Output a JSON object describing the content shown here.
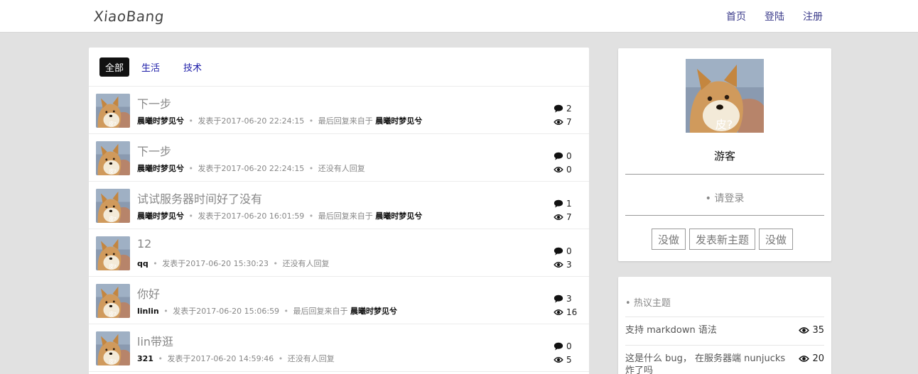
{
  "nav": {
    "logo": "XiaoBang",
    "links": [
      "首页",
      "登陆",
      "注册"
    ]
  },
  "tabs": [
    "全部",
    "生活",
    "技术"
  ],
  "topics": [
    {
      "title": "下一步",
      "author": "晨曦时梦见兮",
      "posted": "发表于2017-06-20 22:24:15",
      "reply_text": "最后回复来自于",
      "replier": "晨曦时梦见兮",
      "comments": "2",
      "views": "7"
    },
    {
      "title": "下一步",
      "author": "晨曦时梦见兮",
      "posted": "发表于2017-06-20 22:24:15",
      "reply_text": "还没有人回复",
      "replier": "",
      "comments": "0",
      "views": "0"
    },
    {
      "title": "试试服务器时间好了没有",
      "author": "晨曦时梦见兮",
      "posted": "发表于2017-06-20 16:01:59",
      "reply_text": "最后回复来自于",
      "replier": "晨曦时梦见兮",
      "comments": "1",
      "views": "7"
    },
    {
      "title": "12",
      "author": "qq",
      "posted": "发表于2017-06-20 15:30:23",
      "reply_text": "还没有人回复",
      "replier": "",
      "comments": "0",
      "views": "3"
    },
    {
      "title": "你好",
      "author": "linlin",
      "posted": "发表于2017-06-20 15:06:59",
      "reply_text": "最后回复来自于",
      "replier": "晨曦时梦见兮",
      "comments": "3",
      "views": "16"
    },
    {
      "title": "lin带逛",
      "author": "321",
      "posted": "发表于2017-06-20 14:59:46",
      "reply_text": "还没有人回复",
      "replier": "",
      "comments": "0",
      "views": "5"
    }
  ],
  "avatar_caption": "皮?",
  "sidebar": {
    "name": "游客",
    "login_hint": "请登录",
    "buttons": [
      "没做",
      "发表新主题",
      "没做"
    ]
  },
  "hot": {
    "title": "热议主题",
    "items": [
      {
        "text": "支持 markdown 语法",
        "views": "35"
      },
      {
        "text": "这是什么 bug， 在服务器端 nunjucks 炸了吗",
        "views": "20"
      }
    ]
  }
}
